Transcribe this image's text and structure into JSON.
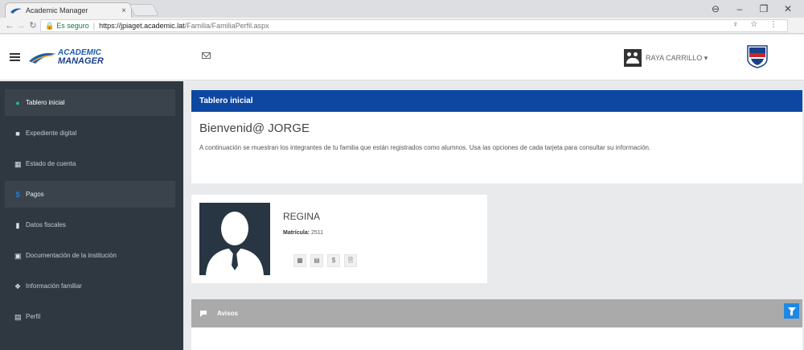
{
  "browser": {
    "tab_title": "Academic Manager",
    "tab_close": "×",
    "win_min": "–",
    "win_max": "❐",
    "win_close": "✕",
    "profile_icon": "⊖",
    "secure_label": "Es seguro",
    "url_host": "https://jpiaget.academic.lat",
    "url_path": "/Familia/FamiliaPerfil.aspx",
    "omni_icons": "♀ ☆ ⋮"
  },
  "header": {
    "logo_line1": "ACADEMIC",
    "logo_line2": "MANAGER",
    "user_name": "RAYA CARRILLO ▾"
  },
  "sidebar": {
    "items": [
      {
        "label": "Tablero inicial",
        "icon": "person-icon"
      },
      {
        "label": "Expediente digital",
        "icon": "folder-icon"
      },
      {
        "label": "Estado de cuenta",
        "icon": "table-icon"
      },
      {
        "label": "Pagos",
        "icon": "dollar-icon"
      },
      {
        "label": "Datos fiscales",
        "icon": "bookmark-icon"
      },
      {
        "label": "Documentación de la institución",
        "icon": "book-icon"
      },
      {
        "label": "Información familiar",
        "icon": "info-icon"
      },
      {
        "label": "Perfil",
        "icon": "id-card-icon"
      }
    ]
  },
  "main": {
    "panel_title": "Tablero inicial",
    "welcome_title": "Bienvenid@ JORGE",
    "welcome_text": "A continuación se muestran los integrantes de tu familia que están registrados como alumnos. Usa las opciones de cada tarjeta para consultar su información."
  },
  "student": {
    "name": "REGINA",
    "matricula_label": "Matrícula:",
    "matricula_value": "2511",
    "actions": [
      "▦",
      "▤",
      "$",
      "🗎"
    ]
  },
  "avisos": {
    "title": "Avisos"
  },
  "colors": {
    "primary": "#0d47a1",
    "sidebar_bg": "#2f3841",
    "accent": "#1e88e5"
  }
}
